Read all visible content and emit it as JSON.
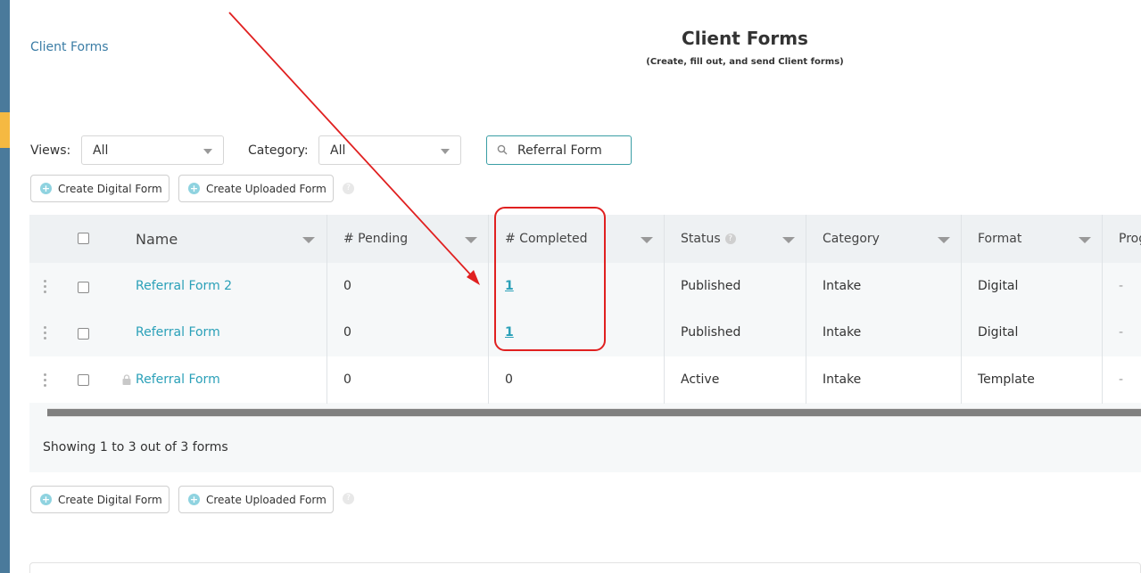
{
  "breadcrumb": "Client Forms",
  "header": {
    "title": "Client Forms",
    "subtitle": "(Create, fill out, and send Client forms)"
  },
  "filters": {
    "views_label": "Views:",
    "views_value": "All",
    "category_label": "Category:",
    "category_value": "All",
    "search_value": "Referral Form"
  },
  "buttons": {
    "create_digital": "Create Digital Form",
    "create_uploaded": "Create Uploaded Form",
    "help": "?"
  },
  "table": {
    "columns": [
      "Name",
      "# Pending",
      "# Completed",
      "Status",
      "Category",
      "Format",
      "Prog"
    ],
    "rows": [
      {
        "name": "Referral Form 2",
        "pending": "0",
        "completed": "1",
        "status": "Published",
        "category": "Intake",
        "format": "Digital",
        "prog": "-"
      },
      {
        "name": "Referral Form",
        "pending": "0",
        "completed": "1",
        "status": "Published",
        "category": "Intake",
        "format": "Digital",
        "prog": "-"
      },
      {
        "name": "Referral Form",
        "pending": "0",
        "completed": "0",
        "status": "Active",
        "category": "Intake",
        "format": "Template",
        "prog": "-"
      }
    ],
    "footer": "Showing 1 to 3 out of 3 forms"
  },
  "colors": {
    "link": "#2aa0b8",
    "annotation": "#e02020",
    "rail": "#4a7a9b",
    "rail_accent": "#f5b942"
  }
}
